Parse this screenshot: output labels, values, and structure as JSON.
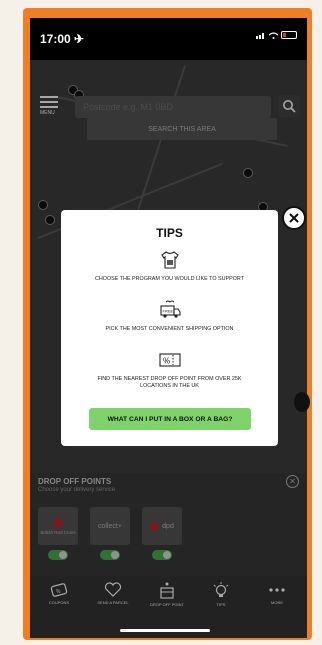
{
  "status_bar": {
    "time": "17:00 ✈︎"
  },
  "header": {
    "menu_label": "MENU",
    "search_placeholder": "Postcode e.g. M1 0BD",
    "search_area_label": "SEARCH THIS AREA"
  },
  "modal": {
    "title": "TIPS",
    "steps": [
      {
        "icon": "shirt-icon",
        "text": "CHOOSE THE PROGRAM YOU WOULD LIKE TO SUPPORT"
      },
      {
        "icon": "free-delivery-van-icon",
        "text": "PICK THE MOST CONVENIENT SHIPPING OPTION"
      },
      {
        "icon": "percent-ticket-icon",
        "text": "FIND THE NEAREST DROP OFF POINT FROM OVER 25K LOCATIONS IN THE UK"
      }
    ],
    "cta_label": "WHAT CAN I PUT IN A BOX OR A BAG?",
    "close_icon": "close-icon"
  },
  "dropoff": {
    "title": "DROP OFF POINTS",
    "subtitle": "Choose your delivery service",
    "carriers": [
      {
        "name": "British Red Cross",
        "enabled": true
      },
      {
        "name": "collect+",
        "enabled": true
      },
      {
        "name": "dpd",
        "enabled": true
      }
    ]
  },
  "tabs": [
    {
      "label": "COUPONS",
      "icon": "coupons-icon"
    },
    {
      "label": "SEND A PARCEL",
      "icon": "heart-icon"
    },
    {
      "label": "DROP OFF POINT",
      "icon": "store-icon"
    },
    {
      "label": "TIPS",
      "icon": "lightbulb-icon"
    },
    {
      "label": "MORE",
      "icon": "more-icon"
    }
  ],
  "colors": {
    "frame": "#ee7f24",
    "cta": "#7fd36b",
    "toggle": "#4caf50"
  }
}
